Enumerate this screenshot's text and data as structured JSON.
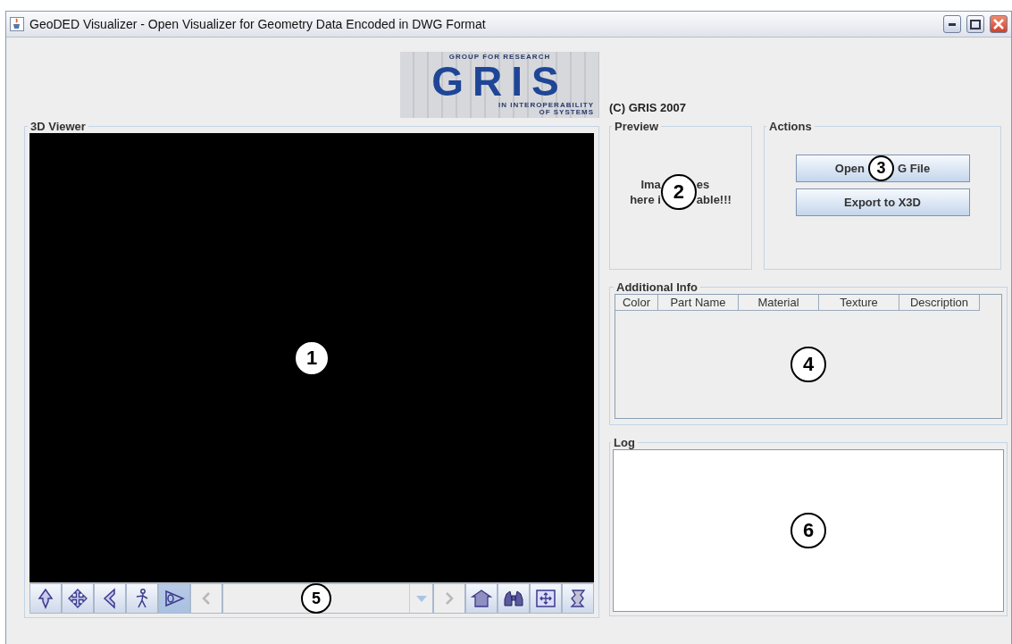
{
  "window": {
    "title": "GeoDED Visualizer - Open Visualizer for Geometry Data Encoded in DWG Format"
  },
  "logo": {
    "top_line": "GROUP FOR RESEARCH",
    "main": "GRIS",
    "bottom_lines": [
      "IN INTEROPERABILITY",
      "OF SYSTEMS"
    ]
  },
  "copyright": "(C) GRIS 2007",
  "viewer": {
    "title": "3D Viewer",
    "callout": "1",
    "toolbar": [
      {
        "kind": "mode",
        "selected": false
      },
      {
        "kind": "mode",
        "selected": false
      },
      {
        "kind": "mode",
        "selected": false
      },
      {
        "kind": "mode",
        "selected": false
      },
      {
        "kind": "mode",
        "selected": true
      },
      {
        "kind": "prev",
        "disabled": true
      },
      {
        "kind": "combo",
        "disabled": true,
        "callout": "5"
      },
      {
        "kind": "next",
        "disabled": true
      },
      {
        "kind": "tool"
      },
      {
        "kind": "tool"
      },
      {
        "kind": "tool"
      },
      {
        "kind": "tool"
      }
    ]
  },
  "preview": {
    "title": "Preview",
    "callout": "2",
    "left_parts": [
      "Ima",
      "here i"
    ],
    "right_parts": [
      "es",
      "able!!!"
    ]
  },
  "actions": {
    "title": "Actions",
    "callout": "3",
    "buttons": [
      {
        "label_parts": [
          "Open",
          "G File"
        ]
      },
      {
        "label_parts": [
          "Export to X3D"
        ]
      }
    ]
  },
  "additional_info": {
    "title": "Additional Info",
    "callout": "4",
    "columns": [
      "Color",
      "Part Name",
      "Material",
      "Texture",
      "Description"
    ]
  },
  "log": {
    "title": "Log",
    "callout": "6"
  }
}
